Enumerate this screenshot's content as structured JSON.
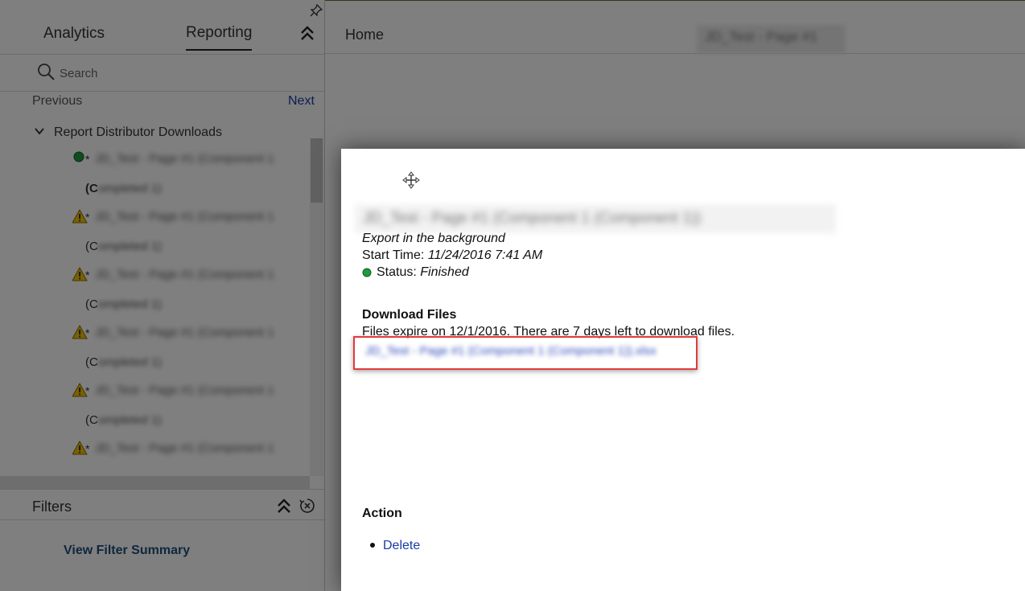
{
  "sidebar": {
    "tabs": [
      {
        "label": "Analytics"
      },
      {
        "label": "Reporting"
      }
    ],
    "search": {
      "placeholder": "Search"
    },
    "pager": {
      "previous": "Previous",
      "next": "Next"
    },
    "tree": {
      "title": "Report Distributor Downloads",
      "items": [
        {
          "status": "success",
          "marker": "*",
          "title": "JD_Test - Page #1 (Component 1",
          "sub_prefix": "(C",
          "sub_rest": "ompleted 1)"
        },
        {
          "status": "warning",
          "marker": "*",
          "title": "JD_Test - Page #1 (Component 1",
          "sub_prefix": "(C",
          "sub_rest": "ompleted 1)"
        },
        {
          "status": "warning",
          "marker": "*",
          "title": "JD_Test - Page #1 (Component 1",
          "sub_prefix": "(C",
          "sub_rest": "ompleted 1)"
        },
        {
          "status": "warning",
          "marker": "*",
          "title": "JD_Test - Page #1 (Component 1",
          "sub_prefix": "(C",
          "sub_rest": "ompleted 1)"
        },
        {
          "status": "warning",
          "marker": "*",
          "title": "JD_Test - Page #1 (Component 1",
          "sub_prefix": "(C",
          "sub_rest": "ompleted 1)"
        },
        {
          "status": "warning",
          "marker": "*",
          "title": "JD_Test - Page #1 (Component 1",
          "sub_prefix": "",
          "sub_rest": ""
        }
      ]
    },
    "filters": {
      "title": "Filters",
      "view_summary": "View Filter Summary"
    }
  },
  "topbar": {
    "home": "Home",
    "title": "JD_Test - Page #1"
  },
  "modal": {
    "title": "JD_Test - Page #1 (Component 1 (Component 1))",
    "export_text": "Export in the background",
    "start_label": "Start Time:",
    "start_value": "11/24/2016 7:41 AM",
    "status_label": "Status:",
    "status_value": "Finished",
    "download_heading": "Download Files",
    "expire_text": "Files expire on 12/1/2016. There are 7 days left to download files.",
    "download_link": "JD_Test - Page #1 (Component 1 (Component 1)).xlsx",
    "action_heading": "Action",
    "delete_label": "Delete"
  },
  "colors": {
    "link": "#1a3aa8",
    "status_success": "#1e9b3c",
    "status_warning": "#f3c200",
    "highlight": "#e23b3b",
    "overlay": "rgba(0,0,0,0.5)"
  }
}
